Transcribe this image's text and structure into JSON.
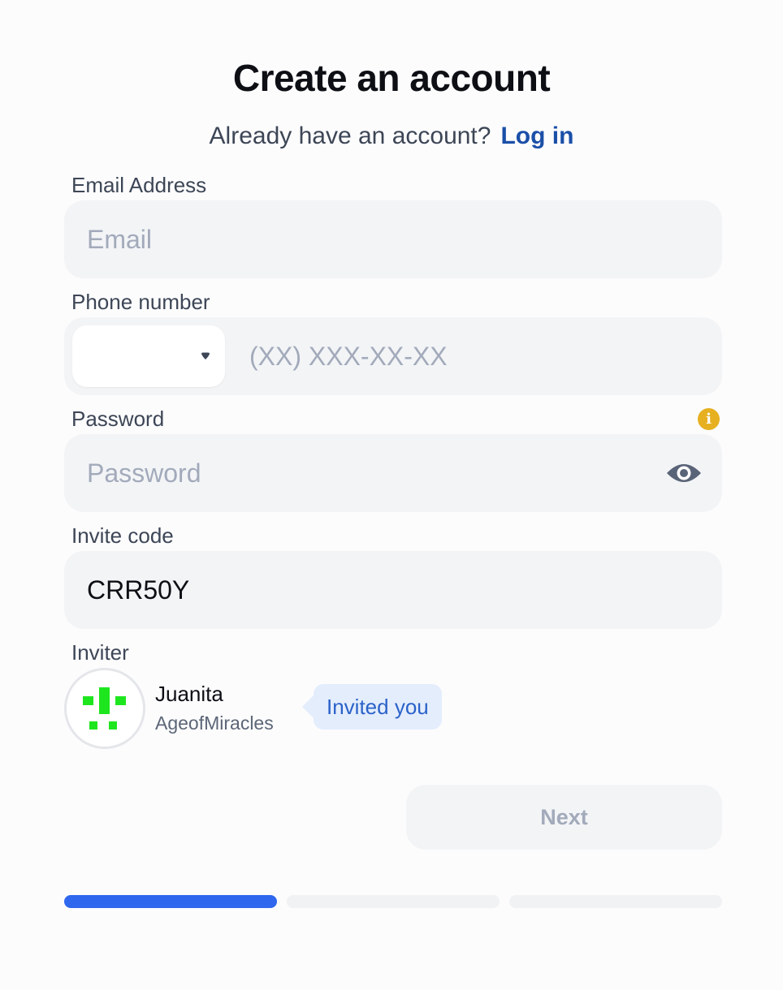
{
  "header": {
    "title": "Create an account",
    "subtitle_prefix": "Already have an account?",
    "login_link": "Log in"
  },
  "form": {
    "email": {
      "label": "Email Address",
      "placeholder": "Email",
      "value": ""
    },
    "phone": {
      "label": "Phone number",
      "country_code": "",
      "placeholder": "(XX) XXX-XX-XX",
      "value": ""
    },
    "password": {
      "label": "Password",
      "placeholder": "Password",
      "value": "",
      "info_icon": "info-icon",
      "toggle_icon": "eye-icon"
    },
    "invite_code": {
      "label": "Invite code",
      "value": "CRR50Y"
    }
  },
  "inviter": {
    "label": "Inviter",
    "name": "Juanita",
    "handle": "AgeofMiracles",
    "badge": "Invited you"
  },
  "actions": {
    "next_label": "Next",
    "next_enabled": false
  },
  "progress": {
    "total_steps": 3,
    "current_step": 1
  },
  "colors": {
    "accent": "#2f67ee",
    "link": "#1b4fa8",
    "info": "#e6b020",
    "avatar_pixels": "#1ee61e",
    "badge_bg": "#e4edfc",
    "badge_text": "#2a62c9"
  }
}
